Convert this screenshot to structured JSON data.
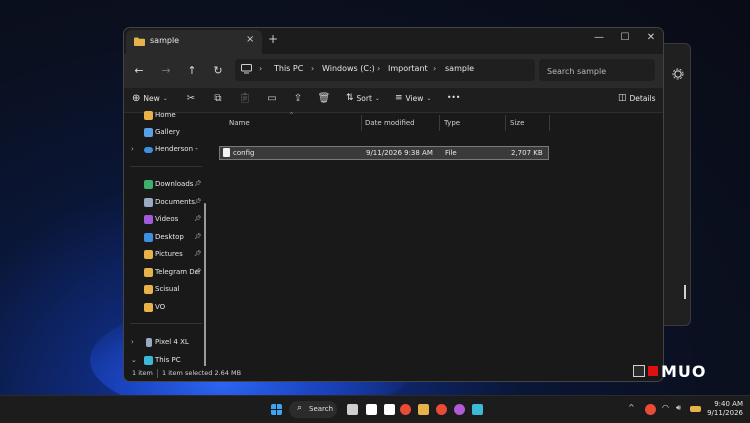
{
  "window": {
    "tab_title": "sample",
    "tab_close": "×",
    "new_tab": "+",
    "minimize": "—",
    "maximize": "☐",
    "close": "✕"
  },
  "nav": {
    "back": "←",
    "forward": "→",
    "up": "↑",
    "refresh": "↻",
    "breadcrumbs": [
      "This PC",
      "Windows (C:)",
      "Important",
      "sample"
    ],
    "search_placeholder": "Search sample"
  },
  "toolbar": {
    "new_label": "New",
    "sort_label": "Sort",
    "view_label": "View",
    "more_label": "•••",
    "details_label": "Details",
    "icons": [
      "cut-icon",
      "copy-icon",
      "paste-icon",
      "rename-icon",
      "share-icon",
      "delete-icon"
    ]
  },
  "sidebar": {
    "items": [
      {
        "label": "Home",
        "icon": "home-icon",
        "color": "#e7b24a"
      },
      {
        "label": "Gallery",
        "icon": "gallery-icon",
        "color": "#5aa0e8"
      },
      {
        "label": "Henderson - Per",
        "icon": "onedrive-icon",
        "color": "#3d8fe0"
      },
      {
        "label": "Downloads",
        "icon": "downloads-icon",
        "color": "#3fb06b"
      },
      {
        "label": "Documents",
        "icon": "documents-icon",
        "color": "#9aa9c4"
      },
      {
        "label": "Videos",
        "icon": "videos-icon",
        "color": "#a25ad8"
      },
      {
        "label": "Desktop",
        "icon": "desktop-icon",
        "color": "#3d8fe0"
      },
      {
        "label": "Pictures",
        "icon": "pictures-icon",
        "color": "#e7b24a"
      },
      {
        "label": "Telegram Des",
        "icon": "folder-icon",
        "color": "#e7b24a"
      },
      {
        "label": "Scisual",
        "icon": "folder-icon",
        "color": "#e7b24a"
      },
      {
        "label": "VO",
        "icon": "folder-icon",
        "color": "#e7b24a"
      },
      {
        "label": "Pixel 4 XL",
        "icon": "phone-icon",
        "color": "#9aa9c4"
      },
      {
        "label": "This PC",
        "icon": "pc-icon",
        "color": "#3db9d8"
      }
    ]
  },
  "columns": {
    "name": "Name",
    "date": "Date modified",
    "type": "Type",
    "size": "Size"
  },
  "files": [
    {
      "name": "config",
      "date": "9/11/2026 9:38 AM",
      "type": "File",
      "size": "2,707 KB"
    }
  ],
  "status": {
    "count": "1 item",
    "selected": "1 item selected  2.64 MB"
  },
  "watermark": "MUO",
  "taskbar": {
    "search_label": "Search",
    "time": "9:40 AM",
    "date": "9/11/2026"
  }
}
